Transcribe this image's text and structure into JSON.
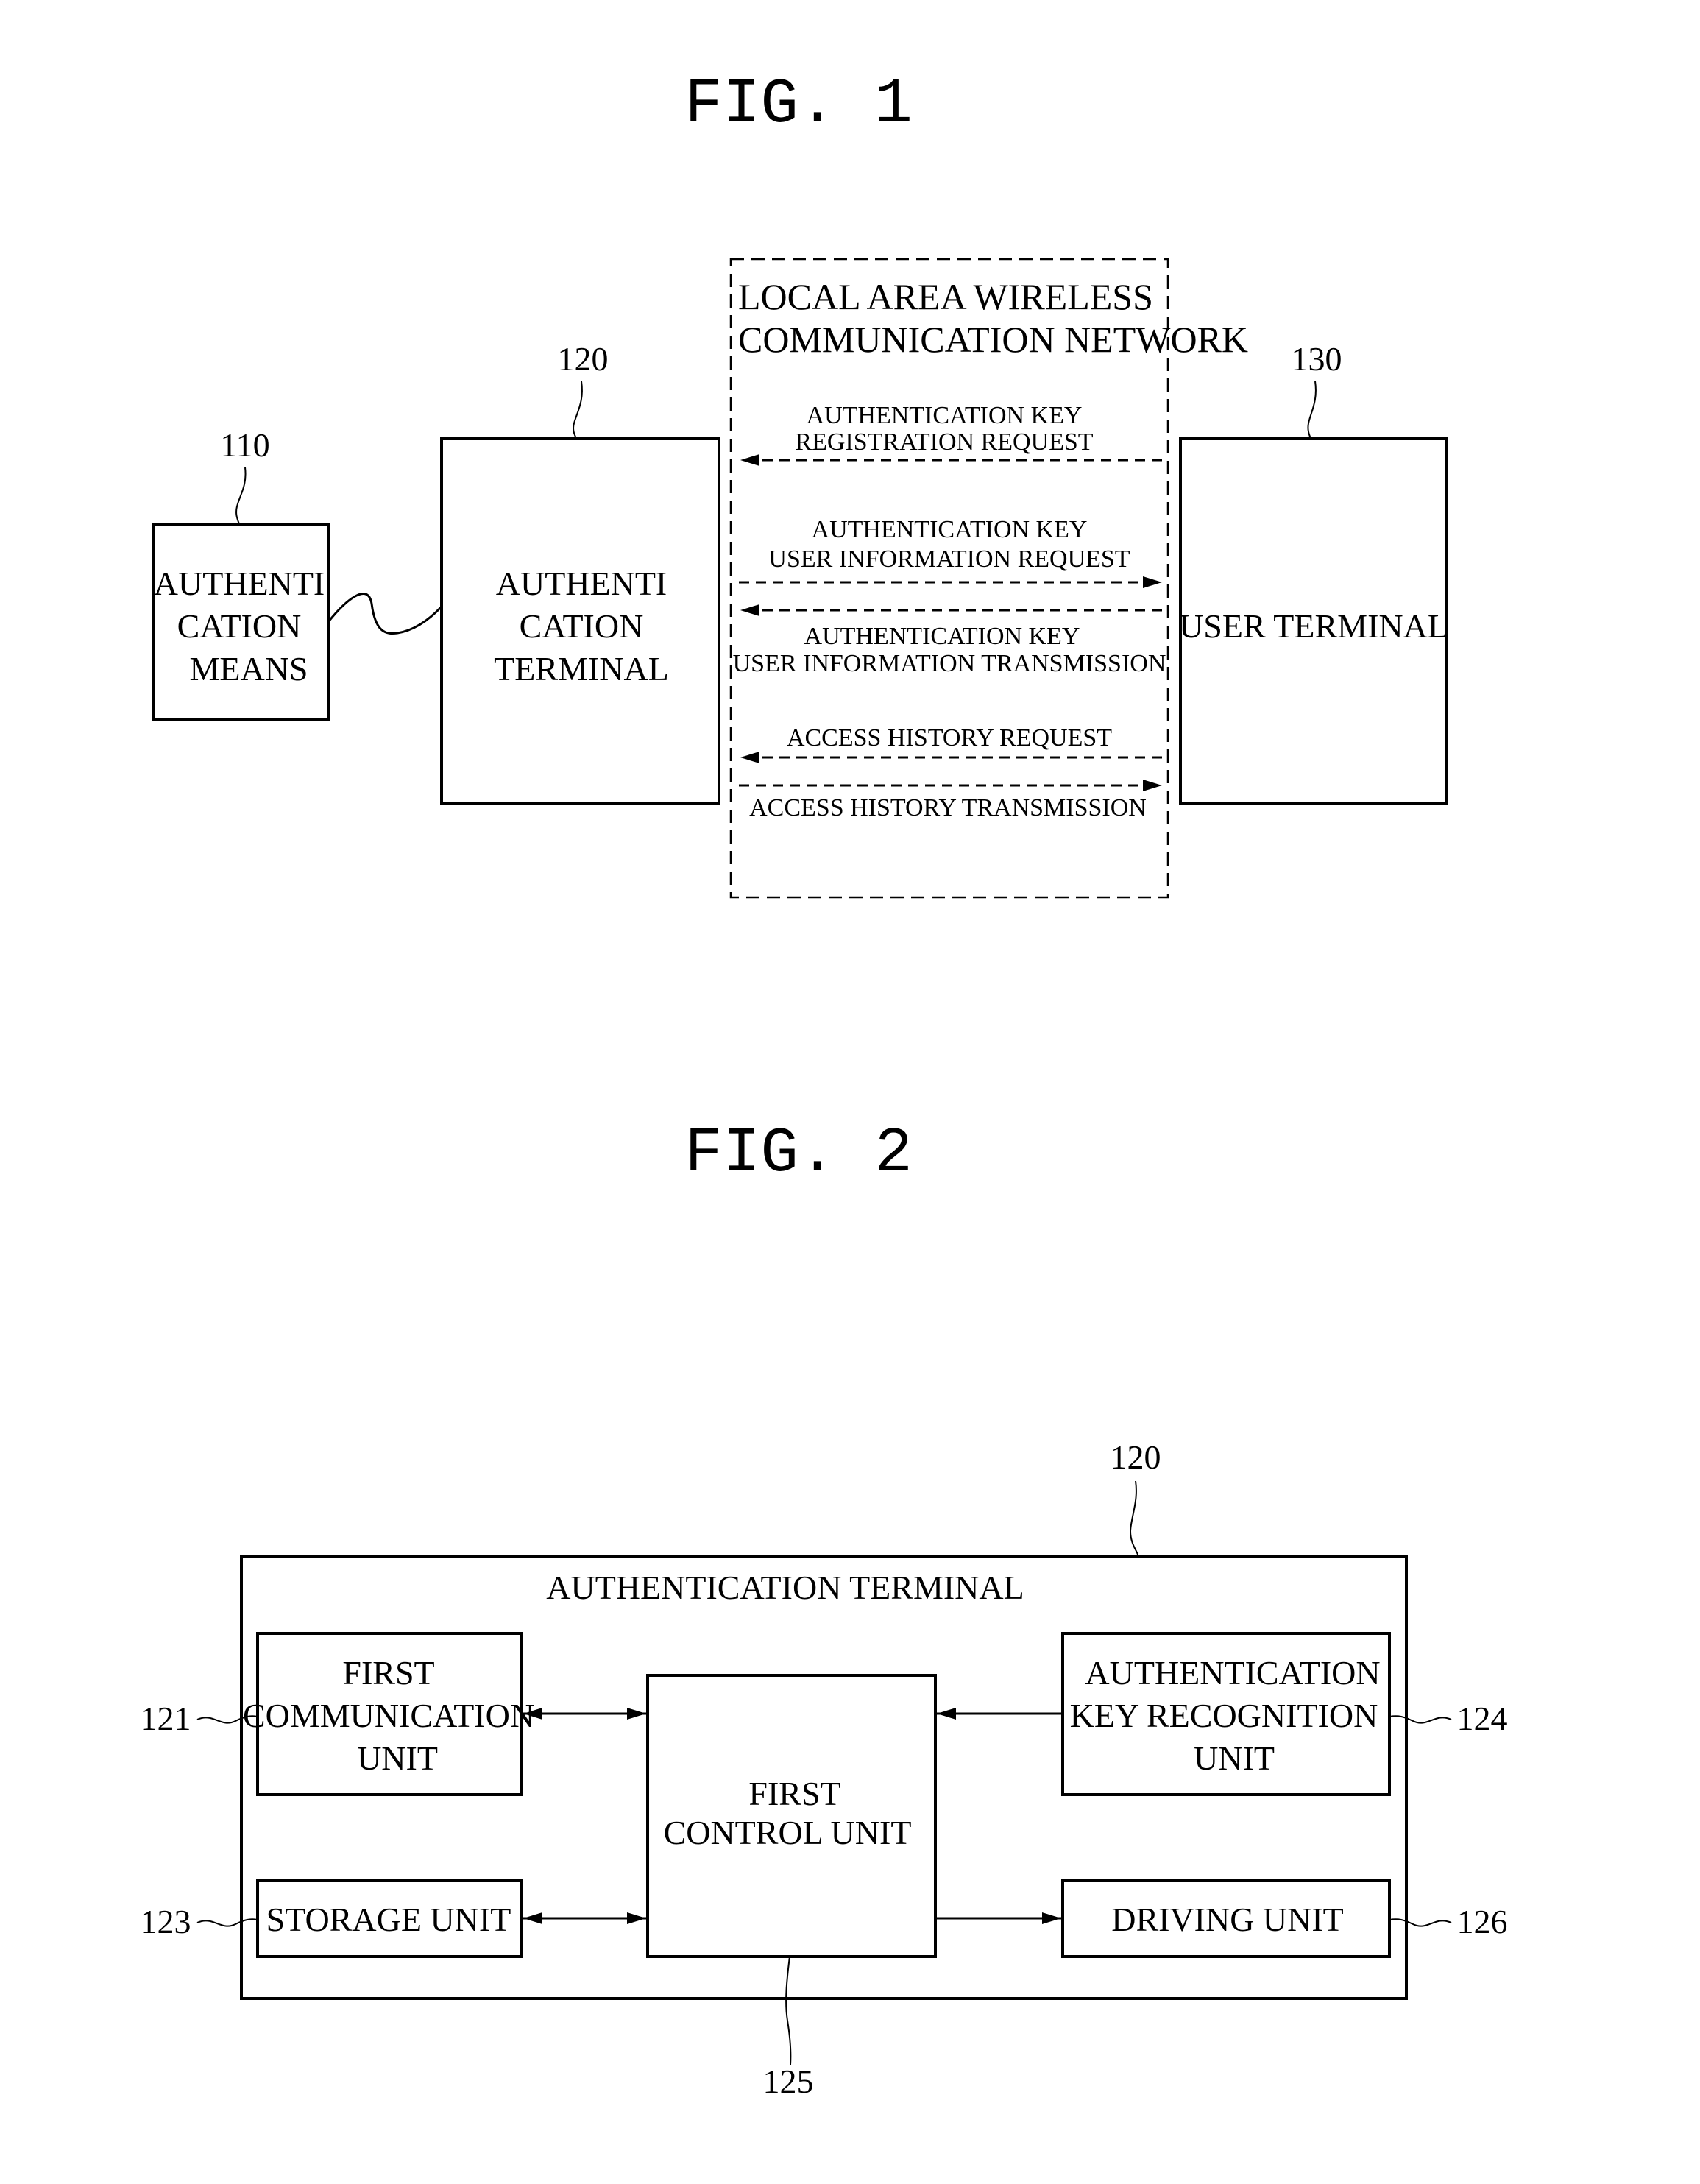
{
  "fig1": {
    "title": "FIG. 1",
    "network": {
      "line1": "LOCAL AREA WIRELESS",
      "line2": "COMMUNICATION NETWORK"
    },
    "auth_means": {
      "ref": "110",
      "lines": [
        "AUTHENTI",
        "CATION",
        "MEANS"
      ]
    },
    "auth_terminal": {
      "ref": "120",
      "lines": [
        "AUTHENTI",
        "CATION",
        "TERMINAL"
      ]
    },
    "user_terminal": {
      "ref": "130",
      "label": "USER TERMINAL"
    },
    "messages": [
      {
        "lines": [
          "AUTHENTICATION KEY",
          "REGISTRATION REQUEST"
        ],
        "direction": "to-authentication-terminal"
      },
      {
        "lines": [
          "AUTHENTICATION KEY",
          "USER INFORMATION REQUEST"
        ],
        "direction": "to-user-terminal"
      },
      {
        "lines": [
          "AUTHENTICATION KEY",
          "USER INFORMATION TRANSMISSION"
        ],
        "direction": "to-authentication-terminal"
      },
      {
        "lines": [
          "ACCESS HISTORY REQUEST"
        ],
        "direction": "to-authentication-terminal"
      },
      {
        "lines": [
          "ACCESS HISTORY TRANSMISSION"
        ],
        "direction": "to-user-terminal"
      }
    ]
  },
  "fig2": {
    "title": "FIG. 2",
    "container": {
      "ref": "120",
      "label": "AUTHENTICATION TERMINAL"
    },
    "units": {
      "first_communication": {
        "ref": "121",
        "lines": [
          "FIRST",
          "COMMUNICATION",
          "UNIT"
        ]
      },
      "storage": {
        "ref": "123",
        "lines": [
          "STORAGE UNIT"
        ]
      },
      "key_recognition": {
        "ref": "124",
        "lines": [
          "AUTHENTICATION",
          "KEY RECOGNITION",
          "UNIT"
        ]
      },
      "first_control": {
        "ref": "125",
        "lines": [
          "FIRST",
          "CONTROL UNIT"
        ]
      },
      "driving": {
        "ref": "126",
        "lines": [
          "DRIVING UNIT"
        ]
      }
    }
  }
}
